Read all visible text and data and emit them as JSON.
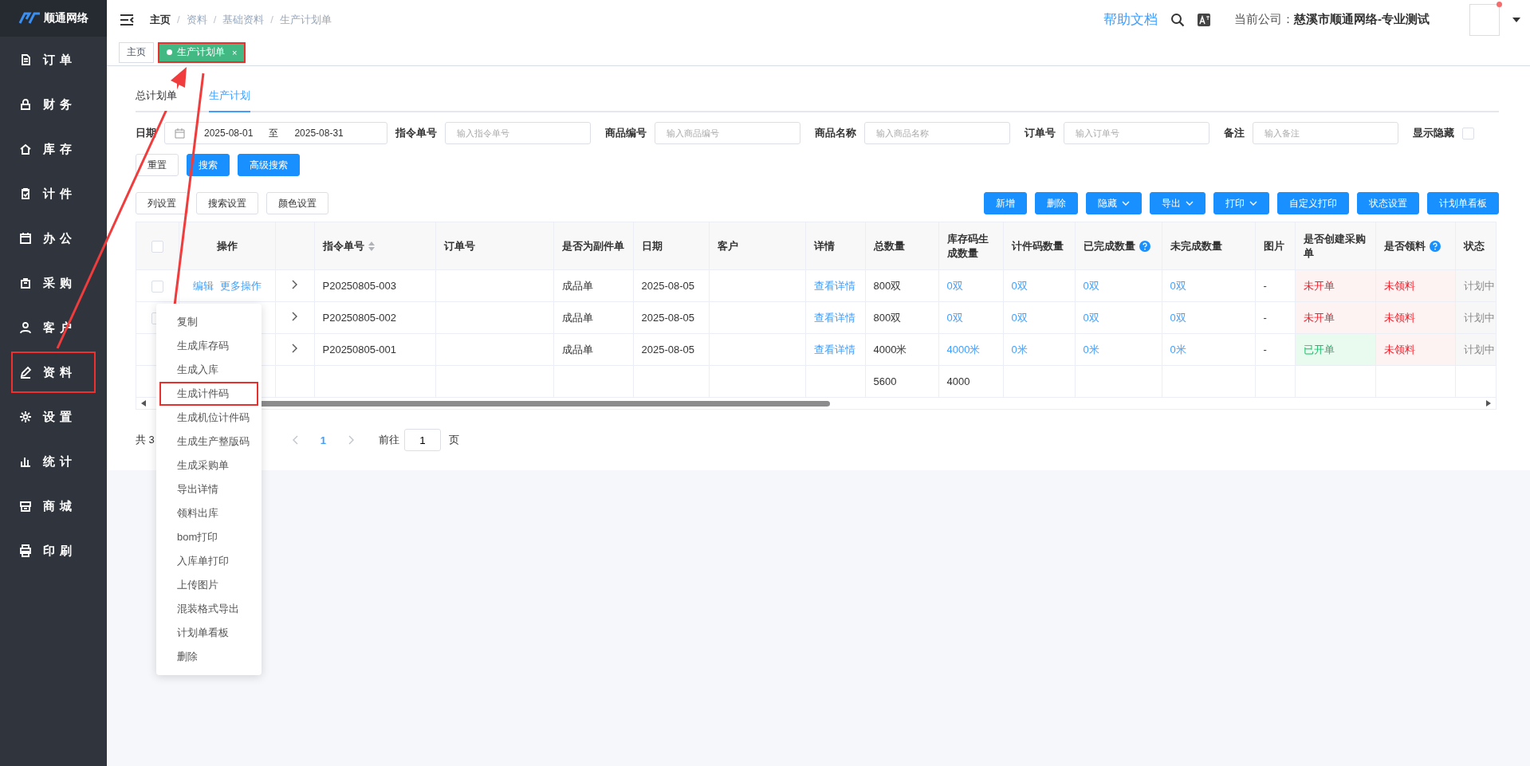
{
  "sidebar": {
    "logo": "顺通网络",
    "items": [
      {
        "label": "订单",
        "highlighted": false
      },
      {
        "label": "财务",
        "highlighted": false
      },
      {
        "label": "库存",
        "highlighted": false
      },
      {
        "label": "计件",
        "highlighted": false
      },
      {
        "label": "办公",
        "highlighted": false
      },
      {
        "label": "采购",
        "highlighted": false
      },
      {
        "label": "客户",
        "highlighted": false
      },
      {
        "label": "资料",
        "highlighted": true
      },
      {
        "label": "设置",
        "highlighted": false
      },
      {
        "label": "统计",
        "highlighted": false
      },
      {
        "label": "商城",
        "highlighted": false
      },
      {
        "label": "印刷",
        "highlighted": false
      }
    ]
  },
  "header": {
    "breadcrumb": [
      "主页",
      "资料",
      "基础资料",
      "生产计划单"
    ],
    "breadcrumb_separator": "/",
    "help": "帮助文档",
    "company_label": "当前公司：",
    "company": "慈溪市顺通网络-专业测试",
    "notification": true
  },
  "page_tabs": [
    {
      "label": "主页",
      "selected": false,
      "highlighted": false
    },
    {
      "label": "生产计划单",
      "selected": true,
      "highlighted": true,
      "close": "×"
    }
  ],
  "sub_tabs": [
    {
      "label": "总计划单",
      "selected": false
    },
    {
      "label": "生产计划",
      "selected": true
    }
  ],
  "filters": {
    "date_label": "日期",
    "date_from": "2025-08-01",
    "date_sep": "至",
    "date_to": "2025-08-31",
    "fields": [
      {
        "label": "指令单号",
        "placeholder": "输入指令单号"
      },
      {
        "label": "商品编号",
        "placeholder": "输入商品编号"
      },
      {
        "label": "商品名称",
        "placeholder": "输入商品名称"
      },
      {
        "label": "订单号",
        "placeholder": "输入订单号"
      },
      {
        "label": "备注",
        "placeholder": "输入备注"
      }
    ],
    "show_hidden": {
      "label": "显示隐藏",
      "checked": false
    }
  },
  "search_buttons": [
    {
      "label": "重置",
      "primary": false
    },
    {
      "label": "搜索",
      "primary": true
    },
    {
      "label": "高级搜索",
      "primary": true
    }
  ],
  "toolbar_left": [
    "列设置",
    "搜索设置",
    "颜色设置"
  ],
  "toolbar_right": [
    {
      "label": "新增",
      "dropdown": false
    },
    {
      "label": "删除",
      "dropdown": false
    },
    {
      "label": "隐藏",
      "dropdown": true
    },
    {
      "label": "导出",
      "dropdown": true
    },
    {
      "label": "打印",
      "dropdown": true
    },
    {
      "label": "自定义打印",
      "dropdown": false
    },
    {
      "label": "状态设置",
      "dropdown": false
    },
    {
      "label": "计划单看板",
      "dropdown": false
    }
  ],
  "table": {
    "select_all": false,
    "action_header": "操作",
    "columns": [
      {
        "label": "指令单号",
        "sortable": true,
        "help": false
      },
      {
        "label": "订单号",
        "sortable": false,
        "help": false
      },
      {
        "label": "是否为副件单",
        "sortable": false,
        "help": false
      },
      {
        "label": "日期",
        "sortable": false,
        "help": false
      },
      {
        "label": "客户",
        "sortable": false,
        "help": false
      },
      {
        "label": "详情",
        "sortable": false,
        "help": false
      },
      {
        "label": "总数量",
        "sortable": false,
        "help": false
      },
      {
        "label": "库存码生成数量",
        "sortable": false,
        "help": false
      },
      {
        "label": "计件码数量",
        "sortable": false,
        "help": false
      },
      {
        "label": "已完成数量",
        "sortable": false,
        "help": true
      },
      {
        "label": "未完成数量",
        "sortable": false,
        "help": false
      },
      {
        "label": "图片",
        "sortable": false,
        "help": false
      },
      {
        "label": "是否创建采购单",
        "sortable": false,
        "help": false
      },
      {
        "label": "是否领料",
        "sortable": false,
        "help": true
      },
      {
        "label": "状态",
        "sortable": false,
        "help": false
      }
    ],
    "rows": [
      {
        "checked": false,
        "actions": [
          "编辑",
          "更多操作"
        ],
        "order_no": "P20250805-003",
        "type": "成品单",
        "date": "2025-08-05",
        "detail": "查看详情",
        "total": "800双",
        "stock_qty": "0双",
        "piece_qty": "0双",
        "done": "0双",
        "undone": "0双",
        "picture": "-",
        "purchase": {
          "text": "未开单",
          "created": false
        },
        "material": {
          "text": "未领料",
          "issued": false
        },
        "status": "计划中"
      },
      {
        "checked": false,
        "order_no": "P20250805-002",
        "type": "成品单",
        "date": "2025-08-05",
        "detail": "查看详情",
        "total": "800双",
        "stock_qty": "0双",
        "piece_qty": "0双",
        "done": "0双",
        "undone": "0双",
        "picture": "-",
        "purchase": {
          "text": "未开单",
          "created": false
        },
        "material": {
          "text": "未领料",
          "issued": false
        },
        "status": "计划中"
      },
      {
        "order_no": "P20250805-001",
        "type": "成品单",
        "date": "2025-08-05",
        "detail": "查看详情",
        "total": "4000米",
        "stock_qty": "4000米",
        "piece_qty": "0米",
        "done": "0米",
        "undone": "0米",
        "picture": "-",
        "purchase": {
          "text": "已开单",
          "created": true
        },
        "material": {
          "text": "未领料",
          "issued": false
        },
        "status": "计划中"
      }
    ],
    "summary": {
      "total": "5600",
      "stock_qty": "4000"
    }
  },
  "context_menu": [
    {
      "label": "复制",
      "highlighted": false
    },
    {
      "label": "生成库存码",
      "highlighted": false
    },
    {
      "label": "生成入库",
      "highlighted": false
    },
    {
      "label": "生成计件码",
      "highlighted": true
    },
    {
      "label": "生成机位计件码",
      "highlighted": false
    },
    {
      "label": "生成生产整版码",
      "highlighted": false
    },
    {
      "label": "生成采购单",
      "highlighted": false
    },
    {
      "label": "导出详情",
      "highlighted": false
    },
    {
      "label": "领料出库",
      "highlighted": false
    },
    {
      "label": "bom打印",
      "highlighted": false
    },
    {
      "label": "入库单打印",
      "highlighted": false
    },
    {
      "label": "上传图片",
      "highlighted": false
    },
    {
      "label": "混装格式导出",
      "highlighted": false
    },
    {
      "label": "计划单看板",
      "highlighted": false
    },
    {
      "label": "删除",
      "highlighted": false
    }
  ],
  "pagination": {
    "total": "共 3",
    "pages": [
      {
        "label": "1",
        "selected": true
      }
    ],
    "goto_label": "前往",
    "goto_value": "1",
    "goto_suffix": "页"
  }
}
